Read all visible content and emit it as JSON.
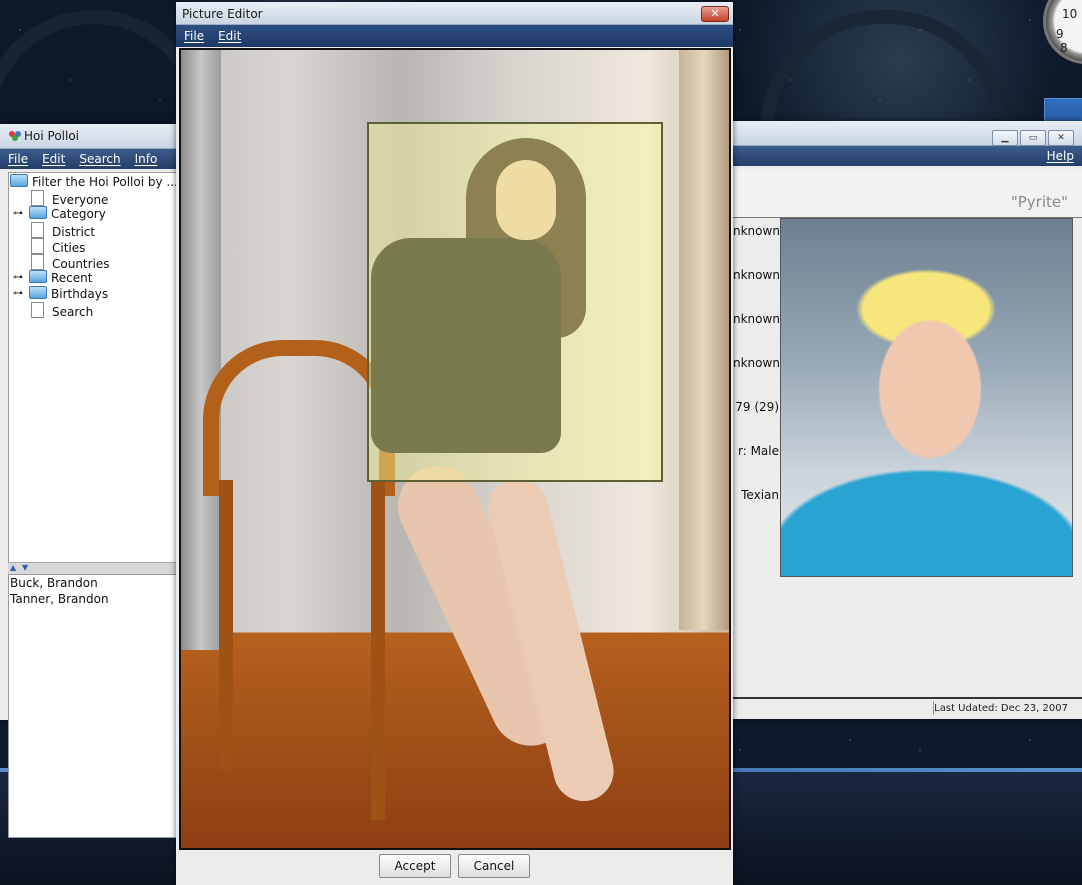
{
  "desktop": {
    "clock_numerals": [
      "10",
      "9",
      "8"
    ]
  },
  "hoi_polloi": {
    "title": "Hoi Polloi",
    "menu": [
      "File",
      "Edit",
      "Search",
      "Info"
    ],
    "tree": {
      "root": "Filter the Hoi Polloi by ...",
      "items": [
        {
          "label": "Everyone",
          "type": "leaf"
        },
        {
          "label": "Category",
          "type": "folder",
          "expandable": true
        },
        {
          "label": "District",
          "type": "leaf"
        },
        {
          "label": "Cities",
          "type": "leaf"
        },
        {
          "label": "Countries",
          "type": "leaf"
        },
        {
          "label": "Recent",
          "type": "folder",
          "expandable": true
        },
        {
          "label": "Birthdays",
          "type": "folder",
          "expandable": true
        },
        {
          "label": "Search",
          "type": "leaf"
        }
      ]
    },
    "results": [
      "Buck, Brandon",
      "Tanner, Brandon"
    ]
  },
  "person_window": {
    "menu_help": "Help",
    "nickname": "\"Pyrite\"",
    "fields": [
      "nknown",
      "nknown",
      "nknown",
      "nknown",
      "79 (29)",
      "r: Male",
      "Texian"
    ],
    "status": "Last Udated: Dec 23, 2007"
  },
  "editor": {
    "title": "Picture Editor",
    "close_glyph": "✕",
    "menu": [
      "File",
      "Edit"
    ],
    "accept_label": "Accept",
    "cancel_label": "Cancel"
  },
  "colors": {
    "menubar": "#2d4f83",
    "crop_overlay": "#f6f696",
    "crop_border": "#5d6234"
  }
}
